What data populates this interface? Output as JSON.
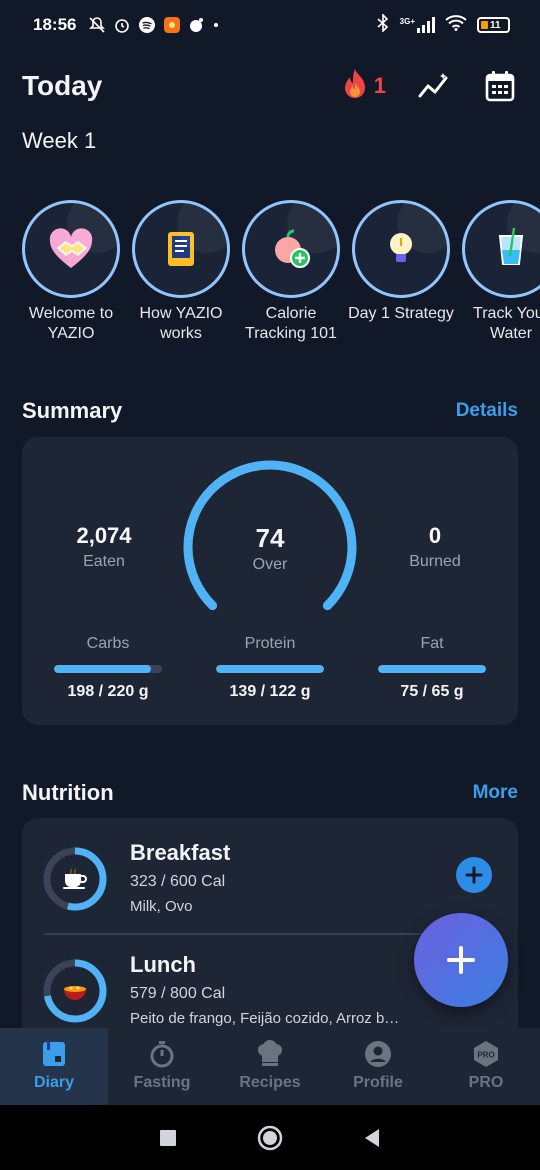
{
  "status_bar": {
    "time": "18:56",
    "network": "3G+",
    "battery": "11"
  },
  "header": {
    "title": "Today",
    "streak_count": "1"
  },
  "week_label": "Week 1",
  "stories": [
    {
      "label": "Welcome to YAZIO",
      "icon": "handshake-icon"
    },
    {
      "label": "How YAZIO works",
      "icon": "phone-book-icon"
    },
    {
      "label": "Calorie Tracking 101",
      "icon": "apple-plus-icon"
    },
    {
      "label": "Day 1 Strategy",
      "icon": "lightbulb-icon"
    },
    {
      "label": "Track Your Water",
      "icon": "water-glass-icon"
    }
  ],
  "summary": {
    "title": "Summary",
    "details_link": "Details",
    "eaten_value": "2,074",
    "eaten_label": "Eaten",
    "center_value": "74",
    "center_label": "Over",
    "burned_value": "0",
    "burned_label": "Burned",
    "macros": [
      {
        "label": "Carbs",
        "value": "198 / 220 g",
        "progress": 0.9
      },
      {
        "label": "Protein",
        "value": "139 / 122 g",
        "progress": 1.0
      },
      {
        "label": "Fat",
        "value": "75 / 65 g",
        "progress": 1.0
      }
    ]
  },
  "nutrition": {
    "title": "Nutrition",
    "more_link": "More",
    "meals": [
      {
        "name": "Breakfast",
        "calories": "323 / 600 Cal",
        "items": "Milk, Ovo",
        "progress": 0.54,
        "icon": "coffee-cup-icon"
      },
      {
        "name": "Lunch",
        "calories": "579 / 800 Cal",
        "items": "Peito de frango, Feijão cozido, Arroz b…",
        "progress": 0.72,
        "icon": "bowl-icon"
      }
    ]
  },
  "bottom_nav": [
    {
      "label": "Diary",
      "active": true,
      "icon": "diary-icon"
    },
    {
      "label": "Fasting",
      "active": false,
      "icon": "stopwatch-icon"
    },
    {
      "label": "Recipes",
      "active": false,
      "icon": "chef-hat-icon"
    },
    {
      "label": "Profile",
      "active": false,
      "icon": "person-icon"
    },
    {
      "label": "PRO",
      "active": false,
      "icon": "pro-badge-icon"
    }
  ],
  "colors": {
    "background": "#111827",
    "card": "#1e2636",
    "accent": "#3b9eea",
    "ring": "#4fb3f6",
    "streak": "#ef4444"
  }
}
